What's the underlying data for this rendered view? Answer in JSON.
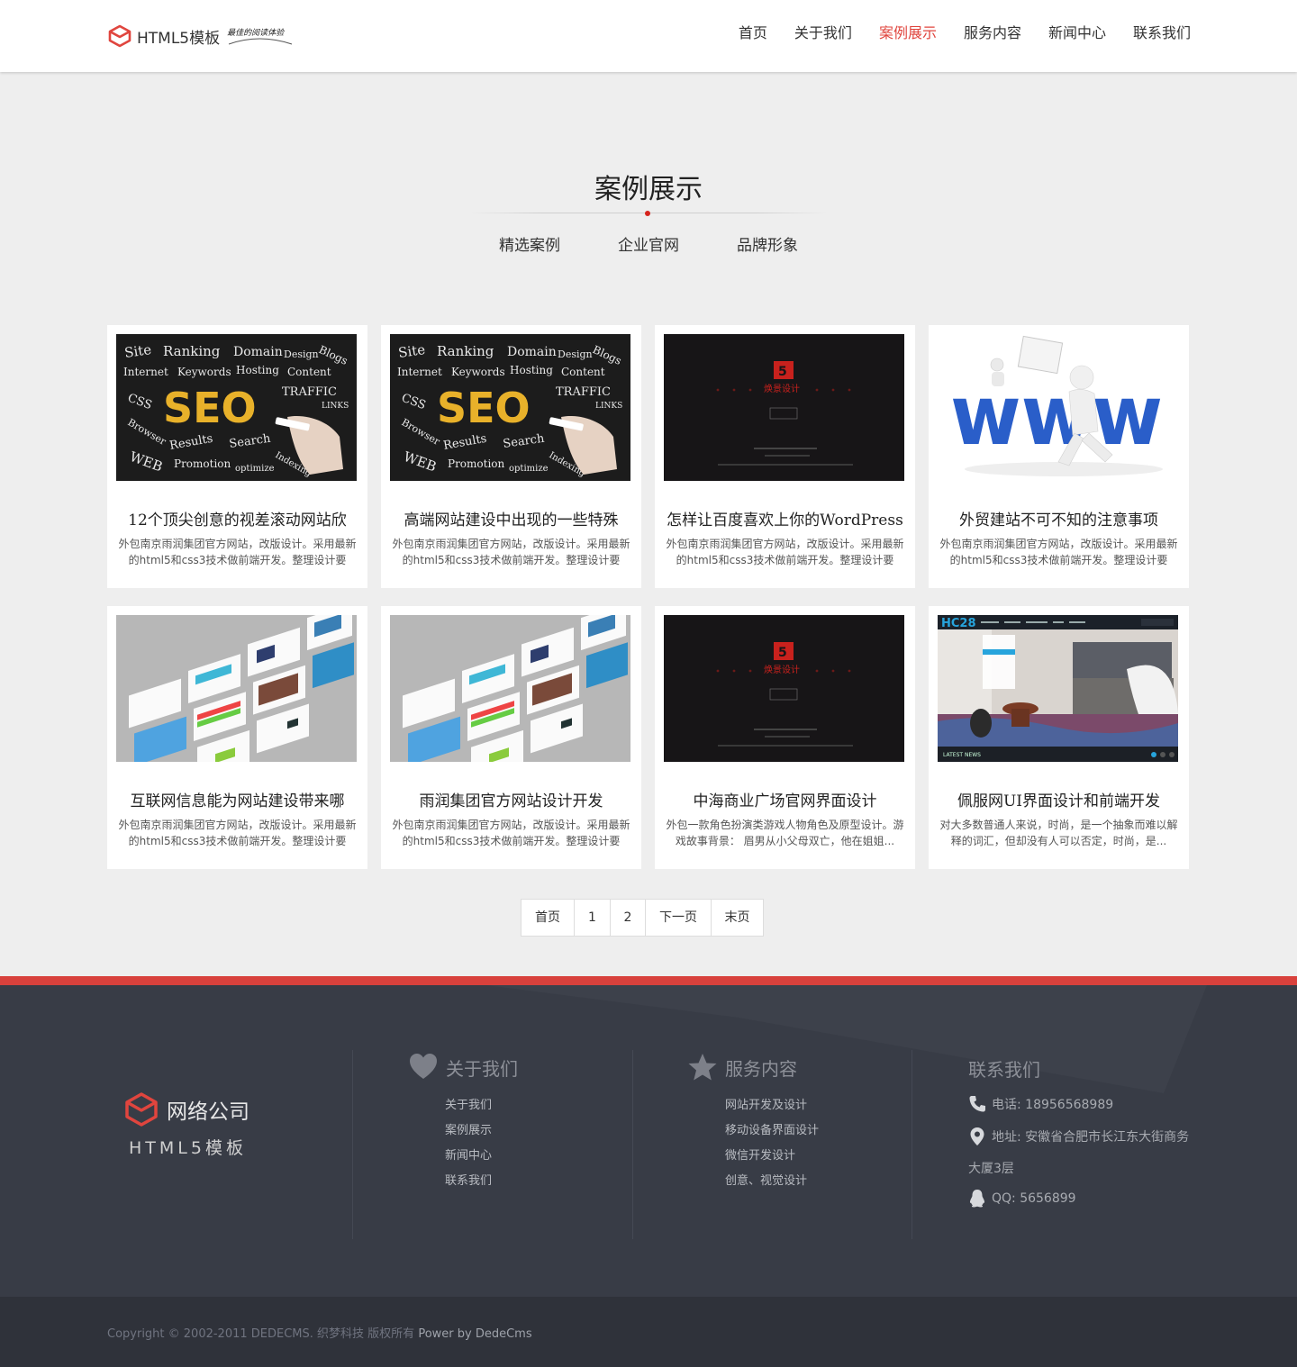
{
  "header": {
    "brand": "HTML5模板",
    "slogan": "最佳的阅读体验",
    "nav": [
      {
        "label": "首页"
      },
      {
        "label": "关于我们"
      },
      {
        "label": "案例展示",
        "active": true
      },
      {
        "label": "服务内容"
      },
      {
        "label": "新闻中心"
      },
      {
        "label": "联系我们"
      }
    ],
    "active_color": "#e0453e"
  },
  "section": {
    "title": "案例展示",
    "tabs": [
      "精选案例",
      "企业官网",
      "品牌形象"
    ]
  },
  "cards": [
    {
      "thumb": "seo-chalkboard",
      "title": "12个顶尖创意的视差滚动网站欣",
      "desc": "外包南京雨润集团官方网站，改版设计。采用最新的html5和css3技术做前端开发。整理设计要求..."
    },
    {
      "thumb": "seo-chalkboard",
      "title": "高端网站建设中出现的一些特殊",
      "desc": "外包南京雨润集团官方网站，改版设计。采用最新的html5和css3技术做前端开发。整理设计要求..."
    },
    {
      "thumb": "dark-design-site",
      "title": "怎样让百度喜欢上你的WordPress",
      "desc": "外包南京雨润集团官方网站，改版设计。采用最新的html5和css3技术做前端开发。整理设计要求..."
    },
    {
      "thumb": "www-figure",
      "title": "外贸建站不可不知的注意事项",
      "desc": "外包南京雨润集团官方网站，改版设计。采用最新的html5和css3技术做前端开发。整理设计要求..."
    },
    {
      "thumb": "business-cards",
      "title": "互联网信息能为网站建设带来哪",
      "desc": "外包南京雨润集团官方网站，改版设计。采用最新的html5和css3技术做前端开发。整理设计要求..."
    },
    {
      "thumb": "business-cards",
      "title": "雨润集团官方网站设计开发",
      "desc": "外包南京雨润集团官方网站，改版设计。采用最新的html5和css3技术做前端开发。整理设计要求..."
    },
    {
      "thumb": "dark-design-site",
      "title": "中海商业广场官网界面设计",
      "desc": "外包一款角色扮演类游戏人物角色及原型设计。游戏故事背景： 眉男从小父母双亡，他在姐姐..."
    },
    {
      "thumb": "hc28-interior",
      "title": "佩服网UI界面设计和前端开发",
      "desc": "对大多数普通人来说，时尚，是一个抽象而难以解释的词汇，但却没有人可以否定，时尚，是..."
    }
  ],
  "pagination": [
    "首页",
    "1",
    "2",
    "下一页",
    "末页"
  ],
  "footer": {
    "brand": "网络公司",
    "subtitle": "HTML5模板",
    "about": {
      "title": "关于我们",
      "icon": "heart-icon",
      "links": [
        "关于我们",
        "案例展示",
        "新闻中心",
        "联系我们"
      ]
    },
    "services": {
      "title": "服务内容",
      "icon": "star-icon",
      "links": [
        "网站开发及设计",
        "移动设备界面设计",
        "微信开发设计",
        "创意、视觉设计"
      ]
    },
    "contact": {
      "title": "联系我们",
      "phone": "电话: 18956568989",
      "address_line1": "地址: 安徽省合肥市长江东大街商务",
      "address_line2": "大厦3层",
      "qq": "QQ: 5656899"
    },
    "copyright": "Copyright © 2002-2011 DEDECMS. 织梦科技 版权所有",
    "power": "Power by DedeCms",
    "accent_color": "#d8413c",
    "bg_color": "#383c46"
  }
}
